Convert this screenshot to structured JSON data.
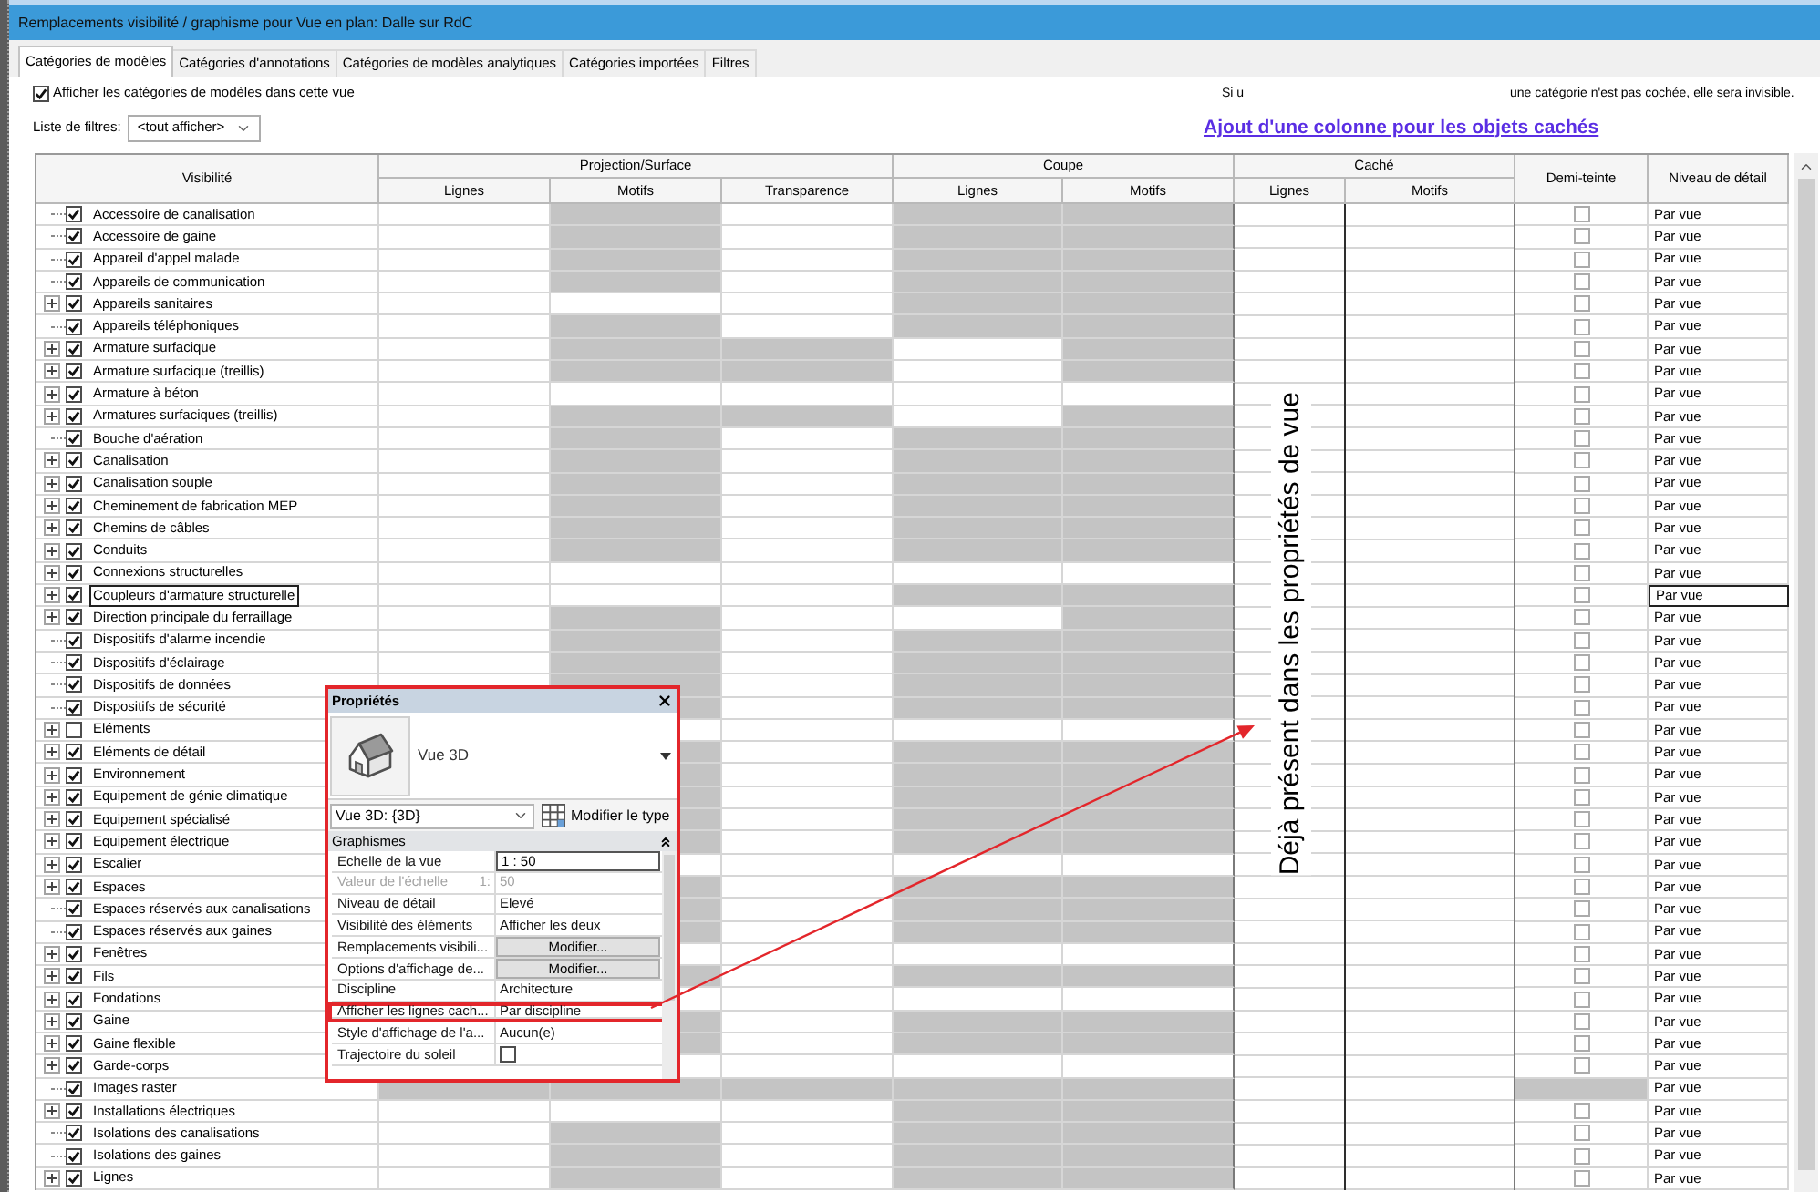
{
  "window": {
    "title": "Remplacements visibilité / graphisme pour Vue en plan: Dalle sur RdC"
  },
  "tabs": [
    {
      "label": "Catégories de modèles",
      "selected": true
    },
    {
      "label": "Catégories d'annotations",
      "selected": false
    },
    {
      "label": "Catégories de modèles analytiques",
      "selected": false
    },
    {
      "label": "Catégories importées",
      "selected": false
    },
    {
      "label": "Filtres",
      "selected": false
    }
  ],
  "show_categories": {
    "label": "Afficher les catégories de modèles dans cette vue",
    "checked": true
  },
  "hint": {
    "part_1": "Si u",
    "part_2": "une catégorie n'est pas cochée, elle sera invisible."
  },
  "filter_list": {
    "label": "Liste de filtres:",
    "value": "<tout afficher>"
  },
  "added_column_link": "Ajout d'une colonne pour les objets cachés",
  "table": {
    "columns": [
      {
        "label": "Visibilité"
      },
      {
        "label": "Projection/Surface",
        "children": [
          "Lignes",
          "Motifs",
          "Transparence"
        ]
      },
      {
        "label": "Coupe",
        "children": [
          "Lignes",
          "Motifs"
        ]
      },
      {
        "label": "Caché",
        "children": [
          "Lignes",
          "Motifs"
        ]
      },
      {
        "label": "Demi-teinte"
      },
      {
        "label": "Niveau de détail"
      }
    ],
    "rows": [
      {
        "label": "Accessoire de canalisation",
        "expandable": false,
        "checked": true,
        "selected": false,
        "shaded": {
          "projection_lines": false,
          "projection_patterns": true,
          "projection_transparency": false,
          "cut_lines": true,
          "cut_patterns": true,
          "halftone": false
        },
        "halftone": false,
        "detail": "Par vue"
      },
      {
        "label": "Accessoire de gaine",
        "expandable": false,
        "checked": true,
        "selected": false,
        "shaded": {
          "projection_lines": false,
          "projection_patterns": true,
          "projection_transparency": false,
          "cut_lines": true,
          "cut_patterns": true,
          "halftone": false
        },
        "halftone": false,
        "detail": "Par vue"
      },
      {
        "label": "Appareil d'appel malade",
        "expandable": false,
        "checked": true,
        "selected": false,
        "shaded": {
          "projection_lines": false,
          "projection_patterns": true,
          "projection_transparency": false,
          "cut_lines": true,
          "cut_patterns": true,
          "halftone": false
        },
        "halftone": false,
        "detail": "Par vue"
      },
      {
        "label": "Appareils de communication",
        "expandable": false,
        "checked": true,
        "selected": false,
        "shaded": {
          "projection_lines": false,
          "projection_patterns": true,
          "projection_transparency": false,
          "cut_lines": true,
          "cut_patterns": true,
          "halftone": false
        },
        "halftone": false,
        "detail": "Par vue"
      },
      {
        "label": "Appareils sanitaires",
        "expandable": true,
        "checked": true,
        "selected": false,
        "shaded": {
          "projection_lines": false,
          "projection_patterns": false,
          "projection_transparency": false,
          "cut_lines": true,
          "cut_patterns": true,
          "halftone": false
        },
        "halftone": false,
        "detail": "Par vue"
      },
      {
        "label": "Appareils téléphoniques",
        "expandable": false,
        "checked": true,
        "selected": false,
        "shaded": {
          "projection_lines": false,
          "projection_patterns": true,
          "projection_transparency": false,
          "cut_lines": true,
          "cut_patterns": true,
          "halftone": false
        },
        "halftone": false,
        "detail": "Par vue"
      },
      {
        "label": "Armature surfacique",
        "expandable": true,
        "checked": true,
        "selected": false,
        "shaded": {
          "projection_lines": false,
          "projection_patterns": true,
          "projection_transparency": true,
          "cut_lines": false,
          "cut_patterns": true,
          "halftone": false
        },
        "halftone": false,
        "detail": "Par vue"
      },
      {
        "label": "Armature surfacique (treillis)",
        "expandable": true,
        "checked": true,
        "selected": false,
        "shaded": {
          "projection_lines": false,
          "projection_patterns": true,
          "projection_transparency": true,
          "cut_lines": false,
          "cut_patterns": true,
          "halftone": false
        },
        "halftone": false,
        "detail": "Par vue"
      },
      {
        "label": "Armature à béton",
        "expandable": true,
        "checked": true,
        "selected": false,
        "shaded": {
          "projection_lines": false,
          "projection_patterns": false,
          "projection_transparency": false,
          "cut_lines": false,
          "cut_patterns": false,
          "halftone": false
        },
        "halftone": false,
        "detail": "Par vue"
      },
      {
        "label": "Armatures surfaciques (treillis)",
        "expandable": true,
        "checked": true,
        "selected": false,
        "shaded": {
          "projection_lines": false,
          "projection_patterns": true,
          "projection_transparency": true,
          "cut_lines": false,
          "cut_patterns": true,
          "halftone": false
        },
        "halftone": false,
        "detail": "Par vue"
      },
      {
        "label": "Bouche d'aération",
        "expandable": false,
        "checked": true,
        "selected": false,
        "shaded": {
          "projection_lines": false,
          "projection_patterns": true,
          "projection_transparency": false,
          "cut_lines": true,
          "cut_patterns": true,
          "halftone": false
        },
        "halftone": false,
        "detail": "Par vue"
      },
      {
        "label": "Canalisation",
        "expandable": true,
        "checked": true,
        "selected": false,
        "shaded": {
          "projection_lines": false,
          "projection_patterns": true,
          "projection_transparency": false,
          "cut_lines": true,
          "cut_patterns": true,
          "halftone": false
        },
        "halftone": false,
        "detail": "Par vue"
      },
      {
        "label": "Canalisation souple",
        "expandable": true,
        "checked": true,
        "selected": false,
        "shaded": {
          "projection_lines": false,
          "projection_patterns": true,
          "projection_transparency": false,
          "cut_lines": true,
          "cut_patterns": true,
          "halftone": false
        },
        "halftone": false,
        "detail": "Par vue"
      },
      {
        "label": "Cheminement de fabrication MEP",
        "expandable": true,
        "checked": true,
        "selected": false,
        "shaded": {
          "projection_lines": false,
          "projection_patterns": true,
          "projection_transparency": false,
          "cut_lines": true,
          "cut_patterns": true,
          "halftone": false
        },
        "halftone": false,
        "detail": "Par vue"
      },
      {
        "label": "Chemins de câbles",
        "expandable": true,
        "checked": true,
        "selected": false,
        "shaded": {
          "projection_lines": false,
          "projection_patterns": true,
          "projection_transparency": false,
          "cut_lines": true,
          "cut_patterns": true,
          "halftone": false
        },
        "halftone": false,
        "detail": "Par vue"
      },
      {
        "label": "Conduits",
        "expandable": true,
        "checked": true,
        "selected": false,
        "shaded": {
          "projection_lines": false,
          "projection_patterns": true,
          "projection_transparency": false,
          "cut_lines": true,
          "cut_patterns": true,
          "halftone": false
        },
        "halftone": false,
        "detail": "Par vue"
      },
      {
        "label": "Connexions structurelles",
        "expandable": true,
        "checked": true,
        "selected": false,
        "shaded": {
          "projection_lines": false,
          "projection_patterns": false,
          "projection_transparency": false,
          "cut_lines": false,
          "cut_patterns": false,
          "halftone": false
        },
        "halftone": false,
        "detail": "Par vue"
      },
      {
        "label": "Coupleurs d'armature structurelle",
        "expandable": true,
        "checked": true,
        "selected": true,
        "shaded": {
          "projection_lines": false,
          "projection_patterns": false,
          "projection_transparency": false,
          "cut_lines": true,
          "cut_patterns": true,
          "halftone": false
        },
        "halftone": false,
        "detail": "Par vue"
      },
      {
        "label": "Direction principale du ferraillage",
        "expandable": true,
        "checked": true,
        "selected": false,
        "shaded": {
          "projection_lines": false,
          "projection_patterns": true,
          "projection_transparency": false,
          "cut_lines": false,
          "cut_patterns": true,
          "halftone": false
        },
        "halftone": false,
        "detail": "Par vue"
      },
      {
        "label": "Dispositifs d'alarme incendie",
        "expandable": false,
        "checked": true,
        "selected": false,
        "shaded": {
          "projection_lines": false,
          "projection_patterns": true,
          "projection_transparency": false,
          "cut_lines": true,
          "cut_patterns": true,
          "halftone": false
        },
        "halftone": false,
        "detail": "Par vue"
      },
      {
        "label": "Dispositifs d'éclairage",
        "expandable": false,
        "checked": true,
        "selected": false,
        "shaded": {
          "projection_lines": false,
          "projection_patterns": true,
          "projection_transparency": false,
          "cut_lines": true,
          "cut_patterns": true,
          "halftone": false
        },
        "halftone": false,
        "detail": "Par vue"
      },
      {
        "label": "Dispositifs de données",
        "expandable": false,
        "checked": true,
        "selected": false,
        "shaded": {
          "projection_lines": false,
          "projection_patterns": true,
          "projection_transparency": false,
          "cut_lines": true,
          "cut_patterns": true,
          "halftone": false
        },
        "halftone": false,
        "detail": "Par vue"
      },
      {
        "label": "Dispositifs de sécurité",
        "expandable": false,
        "checked": true,
        "selected": false,
        "shaded": {
          "projection_patterns": true,
          "projection_transparency": false,
          "cut_lines": true,
          "cut_patterns": true,
          "halftone": false
        },
        "halftone": false,
        "detail": "Par vue"
      },
      {
        "label": "Eléments",
        "expandable": true,
        "checked": false,
        "selected": false,
        "shaded": {
          "projection_patterns": false,
          "projection_transparency": false,
          "cut_lines": false,
          "cut_patterns": false,
          "halftone": false
        },
        "halftone": false,
        "detail": "Par vue"
      },
      {
        "label": "Eléments de détail",
        "expandable": true,
        "checked": true,
        "selected": false,
        "shaded": {
          "projection_patterns": true,
          "projection_transparency": false,
          "cut_lines": true,
          "cut_patterns": true,
          "halftone": false
        },
        "halftone": false,
        "detail": "Par vue"
      },
      {
        "label": "Environnement",
        "expandable": true,
        "checked": true,
        "selected": false,
        "shaded": {
          "projection_patterns": true,
          "projection_transparency": false,
          "cut_lines": true,
          "cut_patterns": true,
          "halftone": false
        },
        "halftone": false,
        "detail": "Par vue"
      },
      {
        "label": "Equipement de génie climatique",
        "expandable": true,
        "checked": true,
        "selected": false,
        "shaded": {
          "projection_patterns": true,
          "projection_transparency": false,
          "cut_lines": true,
          "cut_patterns": true,
          "halftone": false
        },
        "halftone": false,
        "detail": "Par vue"
      },
      {
        "label": "Equipement spécialisé",
        "expandable": true,
        "checked": true,
        "selected": false,
        "shaded": {
          "projection_patterns": true,
          "projection_transparency": false,
          "cut_lines": true,
          "cut_patterns": true,
          "halftone": false
        },
        "halftone": false,
        "detail": "Par vue"
      },
      {
        "label": "Equipement électrique",
        "expandable": true,
        "checked": true,
        "selected": false,
        "shaded": {
          "projection_patterns": true,
          "projection_transparency": false,
          "cut_lines": true,
          "cut_patterns": true,
          "halftone": false
        },
        "halftone": false,
        "detail": "Par vue"
      },
      {
        "label": "Escalier",
        "expandable": true,
        "checked": true,
        "selected": false,
        "shaded": {
          "projection_patterns": false,
          "projection_transparency": false,
          "cut_lines": false,
          "cut_patterns": false,
          "halftone": false
        },
        "halftone": false,
        "detail": "Par vue"
      },
      {
        "label": "Espaces",
        "expandable": true,
        "checked": true,
        "selected": false,
        "shaded": {
          "projection_patterns": true,
          "projection_transparency": false,
          "cut_lines": true,
          "cut_patterns": true,
          "halftone": false
        },
        "halftone": false,
        "detail": "Par vue"
      },
      {
        "label": "Espaces réservés aux canalisations",
        "expandable": false,
        "checked": true,
        "selected": false,
        "shaded": {
          "projection_patterns": true,
          "projection_transparency": false,
          "cut_lines": true,
          "cut_patterns": true,
          "halftone": false
        },
        "halftone": false,
        "detail": "Par vue"
      },
      {
        "label": "Espaces réservés aux gaines",
        "expandable": false,
        "checked": true,
        "selected": false,
        "shaded": {
          "projection_patterns": true,
          "projection_transparency": false,
          "cut_lines": true,
          "cut_patterns": true,
          "halftone": false
        },
        "halftone": false,
        "detail": "Par vue"
      },
      {
        "label": "Fenêtres",
        "expandable": true,
        "checked": true,
        "selected": false,
        "shaded": {
          "projection_patterns": false,
          "projection_transparency": false,
          "cut_lines": false,
          "cut_patterns": false,
          "halftone": false
        },
        "halftone": false,
        "detail": "Par vue"
      },
      {
        "label": "Fils",
        "expandable": true,
        "checked": true,
        "selected": false,
        "shaded": {
          "projection_patterns": true,
          "projection_transparency": false,
          "cut_lines": true,
          "cut_patterns": true,
          "halftone": false
        },
        "halftone": false,
        "detail": "Par vue"
      },
      {
        "label": "Fondations",
        "expandable": true,
        "checked": true,
        "selected": false,
        "shaded": {
          "projection_patterns": false,
          "projection_transparency": false,
          "cut_lines": false,
          "cut_patterns": false,
          "halftone": false
        },
        "halftone": false,
        "detail": "Par vue"
      },
      {
        "label": "Gaine",
        "expandable": true,
        "checked": true,
        "selected": false,
        "shaded": {
          "projection_patterns": true,
          "projection_transparency": false,
          "cut_lines": true,
          "cut_patterns": true,
          "halftone": false
        },
        "halftone": false,
        "detail": "Par vue"
      },
      {
        "label": "Gaine flexible",
        "expandable": true,
        "checked": true,
        "selected": false,
        "shaded": {
          "projection_patterns": true,
          "projection_transparency": false,
          "cut_lines": true,
          "cut_patterns": true,
          "halftone": false
        },
        "halftone": false,
        "detail": "Par vue"
      },
      {
        "label": "Garde-corps",
        "expandable": true,
        "checked": true,
        "selected": false,
        "shaded": {
          "projection_patterns": false,
          "projection_transparency": false,
          "cut_lines": false,
          "cut_patterns": false,
          "halftone": false
        },
        "halftone": false,
        "detail": "Par vue"
      },
      {
        "label": "Images raster",
        "expandable": false,
        "checked": true,
        "selected": false,
        "shaded": {
          "projection_lines": true,
          "projection_patterns": true,
          "projection_transparency": true,
          "cut_lines": true,
          "cut_patterns": true,
          "halftone": true
        },
        "detail": "Par vue"
      },
      {
        "label": "Installations électriques",
        "expandable": true,
        "checked": true,
        "selected": false,
        "shaded": {
          "projection_lines": false,
          "projection_patterns": false,
          "projection_transparency": false,
          "cut_lines": true,
          "cut_patterns": true,
          "halftone": false
        },
        "halftone": false,
        "detail": "Par vue"
      },
      {
        "label": "Isolations des canalisations",
        "expandable": false,
        "checked": true,
        "selected": false,
        "shaded": {
          "projection_lines": false,
          "projection_patterns": true,
          "projection_transparency": false,
          "cut_lines": true,
          "cut_patterns": true,
          "halftone": false
        },
        "halftone": false,
        "detail": "Par vue"
      },
      {
        "label": "Isolations des gaines",
        "expandable": false,
        "checked": true,
        "selected": false,
        "shaded": {
          "projection_lines": false,
          "projection_patterns": true,
          "projection_transparency": false,
          "cut_lines": true,
          "cut_patterns": true,
          "halftone": false
        },
        "halftone": false,
        "detail": "Par vue"
      },
      {
        "label": "Lignes",
        "expandable": true,
        "checked": true,
        "selected": false,
        "shaded": {
          "projection_lines": false,
          "projection_patterns": true,
          "projection_transparency": false,
          "cut_lines": true,
          "cut_patterns": true,
          "halftone": false
        },
        "halftone": false,
        "detail": "Par vue"
      }
    ]
  },
  "properties": {
    "title": "Propriétés",
    "type_name": "Vue 3D",
    "type_selector": "Vue 3D: {3D}",
    "edit_type": "Modifier le type",
    "section": "Graphismes",
    "rows": [
      {
        "kind": "input",
        "label": "Echelle de la vue",
        "value": "1 : 50",
        "disabled": false,
        "highlighted": false
      },
      {
        "kind": "text",
        "label": "Valeur de l'échelle",
        "unit": "1:",
        "value": "50",
        "disabled": true,
        "highlighted": false
      },
      {
        "kind": "text",
        "label": "Niveau de détail",
        "value": "Elevé",
        "disabled": false,
        "highlighted": false
      },
      {
        "kind": "text",
        "label": "Visibilité des éléments",
        "value": "Afficher les deux",
        "disabled": false,
        "highlighted": false
      },
      {
        "kind": "button",
        "label": "Remplacements visibili...",
        "value": "Modifier...",
        "disabled": false,
        "highlighted": false
      },
      {
        "kind": "button",
        "label": "Options d'affichage de...",
        "value": "Modifier...",
        "disabled": false,
        "highlighted": false
      },
      {
        "kind": "text",
        "label": "Discipline",
        "value": "Architecture",
        "disabled": false,
        "highlighted": false
      },
      {
        "kind": "text",
        "label": "Afficher les lignes cach...",
        "value": "Par discipline",
        "disabled": false,
        "highlighted": true
      },
      {
        "kind": "text",
        "label": "Style d'affichage de l'a...",
        "value": "Aucun(e)",
        "disabled": false,
        "highlighted": false
      },
      {
        "kind": "checkbox",
        "label": "Trajectoire du soleil",
        "checked": false,
        "disabled": false,
        "highlighted": false
      }
    ]
  },
  "annotation": {
    "text": "Déjà présent dans les propriétés de vue"
  }
}
